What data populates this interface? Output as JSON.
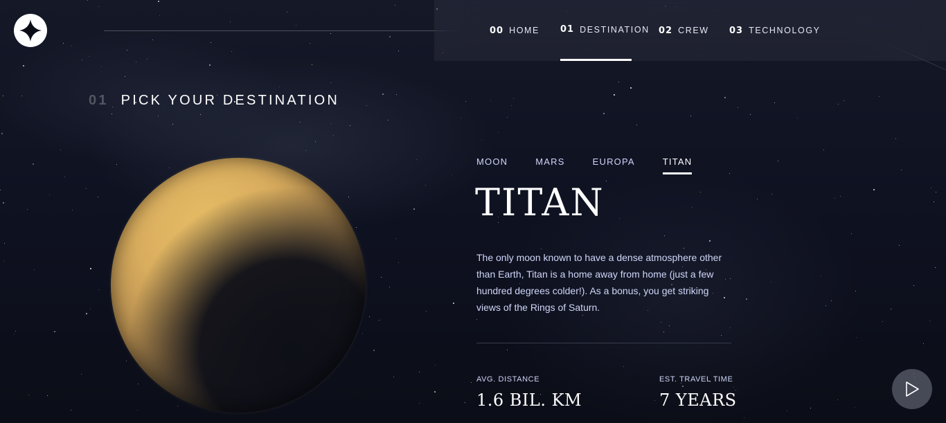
{
  "header": {
    "logo_icon": "star-logo-icon",
    "nav": [
      {
        "num": "00",
        "label": "HOME"
      },
      {
        "num": "01",
        "label": "DESTINATION",
        "active": true
      },
      {
        "num": "02",
        "label": "CREW"
      },
      {
        "num": "03",
        "label": "TECHNOLOGY"
      }
    ]
  },
  "section": {
    "num": "01",
    "title": "PICK YOUR DESTINATION"
  },
  "destination": {
    "tabs": [
      "MOON",
      "MARS",
      "EUROPA",
      "TITAN"
    ],
    "active_tab": "TITAN",
    "name": "TITAN",
    "description": "The only moon known to have a dense atmosphere other than Earth, Titan is a home away from home (just a few hundred degrees colder!). As a bonus, you get striking views of the Rings of Saturn.",
    "stats": {
      "distance_label": "AVG. DISTANCE",
      "distance_value": "1.6 BIL. KM",
      "travel_label": "EST. TRAVEL TIME",
      "travel_value": "7 YEARS"
    }
  },
  "colors": {
    "background": "#0b0d17",
    "accent_text": "#d0d6f9",
    "planet": "#d9ad5e"
  },
  "play_icon": "play-icon"
}
